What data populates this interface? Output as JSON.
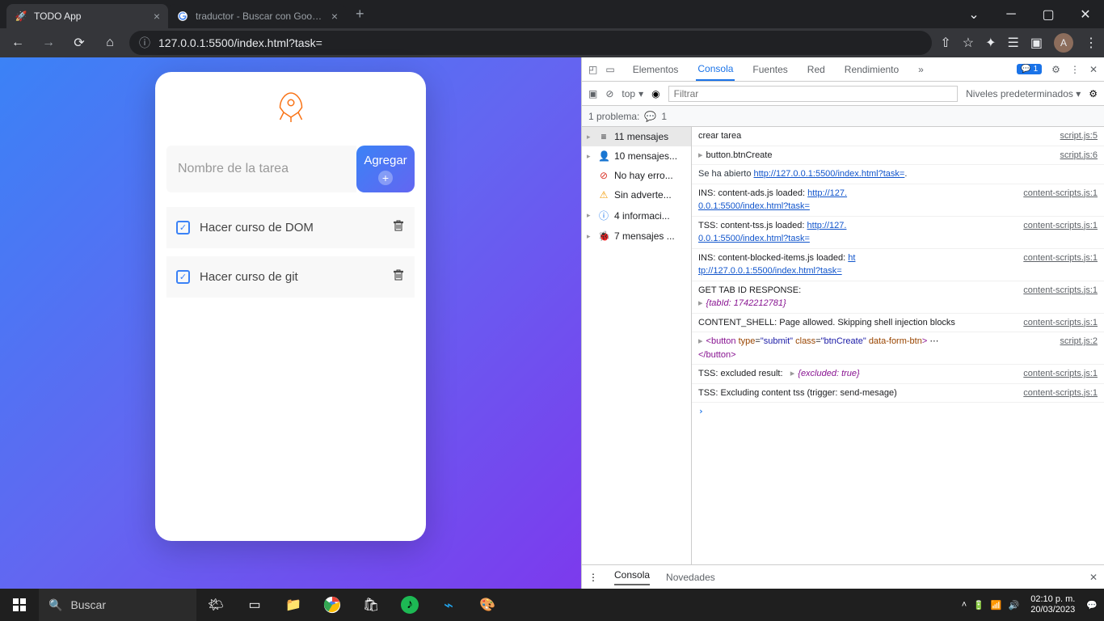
{
  "browser": {
    "tabs": [
      {
        "title": "TODO App",
        "active": true
      },
      {
        "title": "traductor - Buscar con Google",
        "active": false
      }
    ],
    "url": "127.0.0.1:5500/index.html?task=",
    "avatar_letter": "A"
  },
  "todo": {
    "input_placeholder": "Nombre de la tarea",
    "add_label": "Agregar",
    "tasks": [
      {
        "text": "Hacer curso de DOM"
      },
      {
        "text": "Hacer curso de git"
      }
    ]
  },
  "devtools": {
    "tabs": {
      "elements": "Elementos",
      "console": "Consola",
      "sources": "Fuentes",
      "network": "Red",
      "performance": "Rendimiento"
    },
    "issues_count": "1",
    "filter_placeholder": "Filtrar",
    "context": "top",
    "levels": "Niveles predeterminados",
    "problems_label": "1 problema:",
    "problems_count": "1",
    "sidebar": [
      {
        "icon": "≡",
        "text": "11 mensajes"
      },
      {
        "icon": "👤",
        "text": "10 mensajes..."
      },
      {
        "icon": "⛔",
        "text": "No hay erro..."
      },
      {
        "icon": "⚠",
        "text": "Sin adverte..."
      },
      {
        "icon": "ℹ",
        "text": "4 informaci..."
      },
      {
        "icon": "⚙",
        "text": "7 mensajes ..."
      }
    ],
    "logs": [
      {
        "msg": "crear tarea",
        "src": "script.js:5"
      },
      {
        "msg_html": "▸ button.btnCreate",
        "src": "script.js:6"
      },
      {
        "nav": "Se ha abierto ",
        "link": "http://127.0.0.1:5500/index.html?task=",
        "src": ""
      },
      {
        "msg": "INS: content-ads.js loaded:",
        "link": "http://127.0.0.1:5500/index.html?task=",
        "src": "content-scripts.js:1"
      },
      {
        "msg": "TSS: content-tss.js loaded:",
        "link": "http://127.0.0.1:5500/index.html?task=",
        "src": "content-scripts.js:1"
      },
      {
        "msg": "INS: content-blocked-items.js loaded:",
        "link": "http://127.0.0.1:5500/index.html?task=",
        "link_short": "ht",
        "src": "content-scripts.js:1"
      },
      {
        "msg": "GET TAB ID RESPONSE:",
        "obj": "{tabId: 1742212781}",
        "src": "content-scripts.js:1"
      },
      {
        "msg": "CONTENT_SHELL: Page allowed. Skipping shell injection blocks",
        "src": "content-scripts.js:1"
      },
      {
        "element": true,
        "src": "script.js:2"
      },
      {
        "msg": "TSS: excluded result:",
        "obj": "{excluded: true}",
        "src": "content-scripts.js:1"
      },
      {
        "msg": "TSS: Excluding content tss (trigger: send-mesage)",
        "src": "content-scripts.js:1"
      }
    ],
    "element_html": {
      "tag": "button",
      "type": "submit",
      "cls": "btnCreate",
      "attr": "data-form-btn"
    },
    "drawer": {
      "console": "Consola",
      "whatsnew": "Novedades"
    }
  },
  "taskbar": {
    "search_placeholder": "Buscar",
    "time": "02:10 p. m.",
    "date": "20/03/2023"
  }
}
